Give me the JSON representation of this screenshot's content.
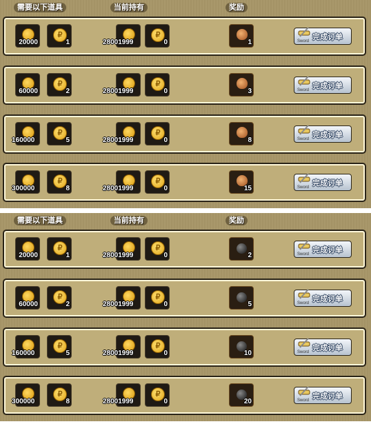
{
  "header": {
    "required": "需要以下道具",
    "holding": "当前持有",
    "reward": "奖励"
  },
  "button": {
    "label": "完成订单",
    "sub": "Sword"
  },
  "panels": [
    {
      "reward_icon": "money-bag-icon",
      "rows": [
        {
          "req_gold": "20000",
          "req_coin": "1",
          "held_gold": "28001999",
          "held_coin": "0",
          "reward": "1"
        },
        {
          "req_gold": "60000",
          "req_coin": "2",
          "held_gold": "28001999",
          "held_coin": "0",
          "reward": "3"
        },
        {
          "req_gold": "160000",
          "req_coin": "5",
          "held_gold": "28001999",
          "held_coin": "0",
          "reward": "8"
        },
        {
          "req_gold": "300000",
          "req_coin": "8",
          "held_gold": "28001999",
          "held_coin": "0",
          "reward": "15"
        }
      ]
    },
    {
      "reward_icon": "bomb-icon",
      "rows": [
        {
          "req_gold": "20000",
          "req_coin": "1",
          "held_gold": "28001999",
          "held_coin": "0",
          "reward": "2"
        },
        {
          "req_gold": "60000",
          "req_coin": "2",
          "held_gold": "28001999",
          "held_coin": "0",
          "reward": "5"
        },
        {
          "req_gold": "160000",
          "req_coin": "5",
          "held_gold": "28001999",
          "held_coin": "0",
          "reward": "10"
        },
        {
          "req_gold": "300000",
          "req_coin": "8",
          "held_gold": "28001999",
          "held_coin": "0",
          "reward": "20"
        }
      ]
    }
  ]
}
